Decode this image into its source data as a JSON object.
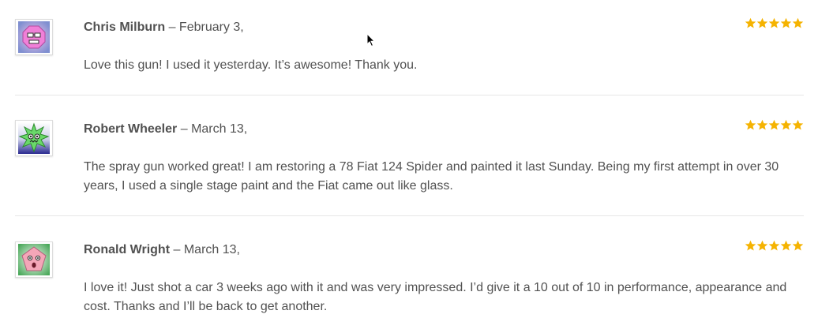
{
  "reviews": [
    {
      "author": "Chris Milburn",
      "separator": "–",
      "date": "February 3,",
      "text": "Love this gun! I used it yesterday. It’s awesome! Thank you.",
      "rating": 5,
      "avatar_icon": "pink-robot-avatar-icon",
      "avatar_color": "#e86cc8"
    },
    {
      "author": "Robert Wheeler",
      "separator": "–",
      "date": "March 13,",
      "text": "The spray gun worked great! I am restoring a 78 Fiat 124 Spider and painted it last Sunday. Being my first attempt in over 30 years, I used a single stage paint and the Fiat came out like glass.",
      "rating": 5,
      "avatar_icon": "green-star-monster-avatar-icon",
      "avatar_color": "#6cd86c"
    },
    {
      "author": "Ronald Wright",
      "separator": "–",
      "date": "March 13,",
      "text": "I love it! Just shot a car 3 weeks ago with it and was very impressed. I’d give it a 10 out of 10 in performance, appearance and cost. Thanks and I’ll be back to get another.",
      "rating": 5,
      "avatar_icon": "pink-pentagon-avatar-icon",
      "avatar_color": "#f4a6b8"
    }
  ],
  "colors": {
    "star": "#f5b301",
    "text": "#515151",
    "divider": "#e6e6e6"
  }
}
